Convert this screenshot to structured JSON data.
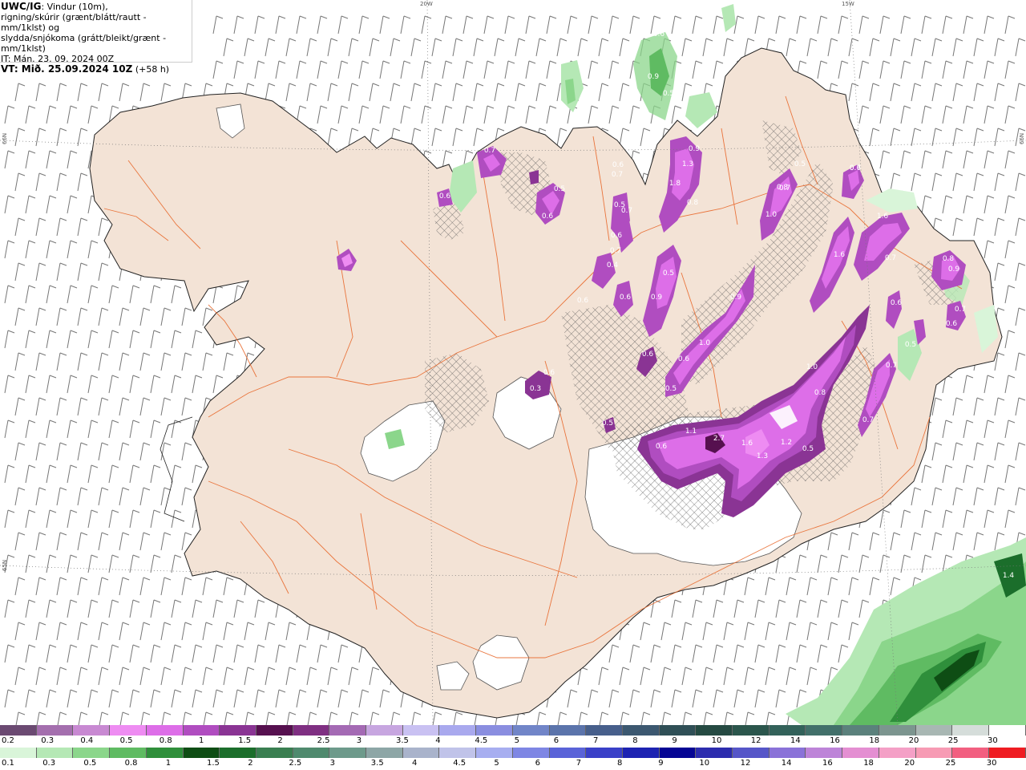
{
  "header": {
    "model": "UWC/IG",
    "line1_rest": ": Vindur (10m),",
    "line2": "rigning/skúrir (grænt/blátt/rautt - mm/1klst) og",
    "line3": "slydda/snjókoma (grátt/bleikt/grænt - mm/1klst)",
    "line4": "IT: Mán. 23. 09. 2024 00Z",
    "line5_prefix": "VT: Mið. 25.09.2024 10Z",
    "line5_suffix": " (+58 h)"
  },
  "graticule": {
    "lon_20w": "20W",
    "lon_15w": "15W",
    "lat_66n_left": "66N",
    "lat_66n_right": "66N",
    "lat_65n_left": "65N"
  },
  "precip_labels": [
    "0.6",
    "0.9",
    "0.5",
    "0.7",
    "0.6",
    "0.6",
    "0.5",
    "0.6",
    "0.7",
    "0.9",
    "1.3",
    "1.8",
    "0.8",
    "0.5",
    "0.7",
    "0.6",
    "0.7",
    "0.4",
    "0.6",
    "0.6",
    "0.5",
    "0.9",
    "0.6",
    "0.5",
    "0.6",
    "1.0",
    "0.9",
    "1.0",
    "0.8",
    "0.5",
    "0.7",
    "1.6",
    "0.7",
    "1.6",
    "0.9",
    "0.8",
    "0.6",
    "2.7",
    "0.6",
    "1.1",
    "1.6",
    "1.3",
    "1.2",
    "0.5",
    "0.7",
    "1.0",
    "0.8",
    "0.5",
    "0.7",
    "0.6",
    "0.5",
    "0.3",
    "0.6",
    "0.7",
    "0.6",
    "1.4",
    "0.7"
  ],
  "legend": {
    "snow_colors": [
      "#6b4a72",
      "#a46fae",
      "#c889d2",
      "#ee8cf2",
      "#dd6ee8",
      "#b04dc0",
      "#8a3494",
      "#56104f",
      "#7f2f82",
      "#a46ab4",
      "#c7a6e0",
      "#c9c1f2",
      "#a9a9ee",
      "#8a8ee0",
      "#7185c8",
      "#5b74ab",
      "#475f8b",
      "#3c5870",
      "#2f4f56",
      "#254a42",
      "#2b564c",
      "#33625a",
      "#42706a",
      "#5b817c",
      "#7c958f",
      "#a8b7b3",
      "#d5ddda",
      "#ffffff"
    ],
    "snow_labels": [
      "0.2",
      "0.3",
      "0.4",
      "0.5",
      "0.8",
      "1",
      "1.5",
      "2",
      "2.5",
      "3",
      "3.5",
      "4",
      "4.5",
      "5",
      "6",
      "7",
      "8",
      "9",
      "10",
      "12",
      "14",
      "16",
      "18",
      "20",
      "25",
      "30"
    ],
    "rain_colors": [
      "#d9f5d9",
      "#b5e8b5",
      "#8bd68b",
      "#5fbb62",
      "#2f8f3b",
      "#0e4d14",
      "#1b6e2b",
      "#3a7f51",
      "#4f8a6e",
      "#6d9a8b",
      "#8da6a6",
      "#a9b3cb",
      "#c0c3e9",
      "#a7aef0",
      "#7e86e4",
      "#5a63d8",
      "#3a40c8",
      "#1d23b2",
      "#050594",
      "#2c2cae",
      "#5656c8",
      "#8a72d8",
      "#bd84d8",
      "#e48fd2",
      "#f4a0c6",
      "#f79bb4",
      "#f25f80",
      "#ef1c22"
    ],
    "rain_labels": [
      "0.1",
      "0.3",
      "0.5",
      "0.8",
      "1",
      "1.5",
      "2",
      "2.5",
      "3",
      "3.5",
      "4",
      "4.5",
      "5",
      "6",
      "7",
      "8",
      "9",
      "10",
      "12",
      "14",
      "16",
      "18",
      "20",
      "25",
      "30"
    ]
  }
}
